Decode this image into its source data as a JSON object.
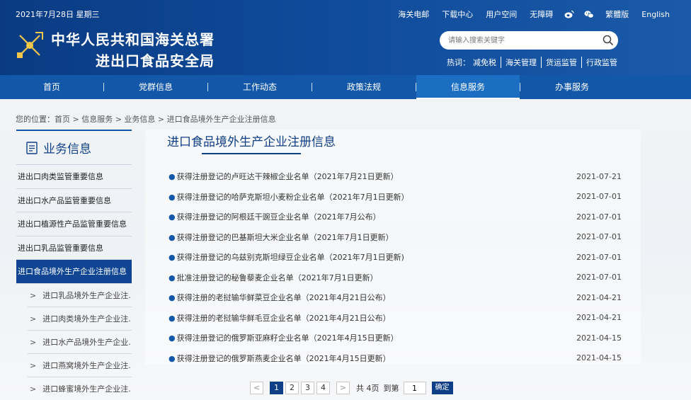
{
  "header": {
    "date": "2021年7月28日 星期三",
    "org_line1": "中华人民共和国海关总署",
    "org_line2": "进出口食品安全局",
    "top_links": [
      "海关电邮",
      "下载中心",
      "用户空间",
      "无障碍",
      "繁體版",
      "English"
    ],
    "social_icons": [
      "weibo-icon",
      "wechat-icon"
    ],
    "search": {
      "placeholder": "请输入搜索关键字"
    },
    "hot_label": "热词：",
    "hot_words": [
      "减免税",
      "海关管理",
      "货运监管",
      "行政监管"
    ]
  },
  "nav": {
    "items": [
      "首页",
      "党群信息",
      "工作动态",
      "政策法规",
      "信息服务",
      "办事服务"
    ],
    "active": "信息服务"
  },
  "breadcrumb": "您的位置：首页 > 信息服务 > 业务信息 > 进口食品境外生产企业注册信息",
  "sidebar": {
    "title": "业务信息",
    "items": [
      "进出口肉类监管重要信息",
      "进出口水产品监管重要信息",
      "进出口植源性产品监管重要信息",
      "进出口乳品监管重要信息",
      "进口食品境外生产企业注册信息"
    ],
    "active": "进口食品境外生产企业注册信息",
    "subitems": [
      "进口乳品境外生产企业注...",
      "进口肉类境外生产企业注...",
      "进口水产品境外生产企业...",
      "进口燕窝境外生产企业注...",
      "进口蜂蜜境外生产企业注..."
    ]
  },
  "main": {
    "title": "进口食品境外生产企业注册信息",
    "news": [
      {
        "title": "获得注册登记的卢旺达干辣椒企业名单（2021年7月21日更新）",
        "date": "2021-07-21"
      },
      {
        "title": "获得注册登记的哈萨克斯坦小麦粉企业名单（2021年7月1日更新）",
        "date": "2021-07-01"
      },
      {
        "title": "获得注册登记的阿根廷干豌豆企业名单（2021年7月公布）",
        "date": "2021-07-01"
      },
      {
        "title": "获得注册登记的巴基斯坦大米企业名单（2021年7月1日更新）",
        "date": "2021-07-01"
      },
      {
        "title": "获得注册登记的乌兹别克斯坦绿豆企业名单（2021年7月1日更新)",
        "date": "2021-07-01"
      },
      {
        "title": "批准注册登记的秘鲁藜麦企业名单（2021年7月1日更新）",
        "date": "2021-07-01"
      },
      {
        "title": "获得注册的老挝输华鲜菜豆企业名单（2021年4月21日公布）",
        "date": "2021-04-21"
      },
      {
        "title": "获得注册的老挝输华鲜毛豆企业名单（2021年4月21日公布）",
        "date": "2021-04-21"
      },
      {
        "title": "获得注册登记的俄罗斯亚麻籽企业名单（2021年4月15日更新）",
        "date": "2021-04-15"
      },
      {
        "title": "获得注册登记的俄罗斯燕麦企业名单（2021年4月15日更新）",
        "date": "2021-04-15"
      }
    ]
  },
  "pager": {
    "prev": "<",
    "next": ">",
    "pages": [
      "1",
      "2",
      "3",
      "4"
    ],
    "current": "1",
    "total_text": "共 4页",
    "goto_text": "到第",
    "goto_value": "1",
    "confirm": "确定"
  },
  "colors": {
    "header_bg": "#0f4a9a",
    "nav_bg": "#1358a8",
    "accent": "#0f3f86"
  }
}
